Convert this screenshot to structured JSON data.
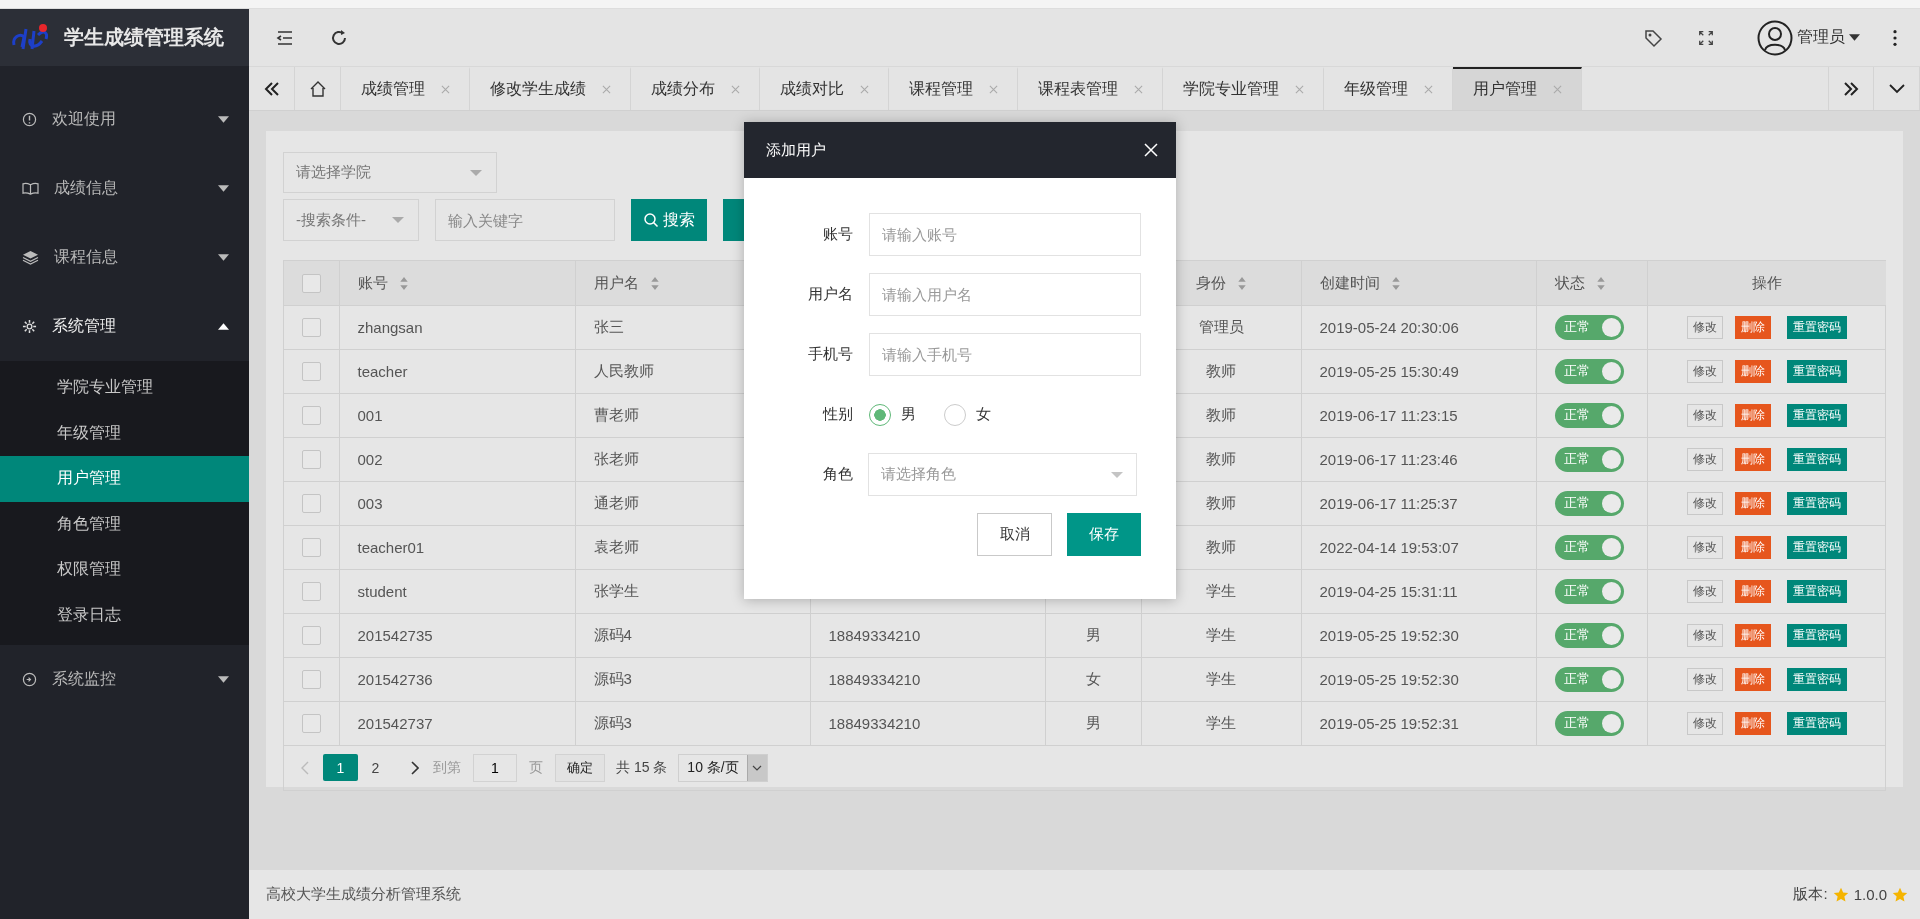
{
  "app": {
    "title": "学生成绩管理系统"
  },
  "sidebar": {
    "items": [
      {
        "label": "欢迎使用",
        "expanded": false
      },
      {
        "label": "成绩信息",
        "expanded": false
      },
      {
        "label": "课程信息",
        "expanded": false
      },
      {
        "label": "系统管理",
        "expanded": true,
        "children": [
          {
            "label": "学院专业管理",
            "selected": false
          },
          {
            "label": "年级管理",
            "selected": false
          },
          {
            "label": "用户管理",
            "selected": true
          },
          {
            "label": "角色管理",
            "selected": false
          },
          {
            "label": "权限管理",
            "selected": false
          },
          {
            "label": "登录日志",
            "selected": false
          }
        ]
      },
      {
        "label": "系统监控",
        "expanded": false
      }
    ]
  },
  "header": {
    "user": "管理员"
  },
  "tabs": [
    {
      "label": "成绩管理",
      "selected": false
    },
    {
      "label": "修改学生成绩",
      "selected": false
    },
    {
      "label": "成绩分布",
      "selected": false
    },
    {
      "label": "成绩对比",
      "selected": false
    },
    {
      "label": "课程管理",
      "selected": false
    },
    {
      "label": "课程表管理",
      "selected": false
    },
    {
      "label": "学院专业管理",
      "selected": false
    },
    {
      "label": "年级管理",
      "selected": false
    },
    {
      "label": "用户管理",
      "selected": true
    }
  ],
  "filters": {
    "college_placeholder": "请选择学院",
    "condition_placeholder": "-搜索条件-",
    "keyword_placeholder": "输入关键字",
    "search_button": "搜索"
  },
  "table": {
    "all_checked": false,
    "columns": [
      {
        "label": "账号",
        "sortable": true
      },
      {
        "label": "用户名",
        "sortable": true
      },
      {},
      {},
      {
        "label": "身份",
        "sortable": true
      },
      {
        "label": "创建时间",
        "sortable": true
      },
      {
        "label": "状态",
        "sortable": true
      },
      {
        "label": "操作",
        "sortable": false
      }
    ],
    "rows": [
      {
        "checked": false,
        "account": "zhangsan",
        "name": "张三",
        "role": "管理员",
        "created": "2019-05-24 20:30:06",
        "status": {
          "on": true,
          "label": "正常"
        },
        "actions": [
          {
            "kind": "edit",
            "label": "修改"
          },
          {
            "kind": "delete",
            "label": "删除"
          },
          {
            "kind": "reset",
            "label": "重置密码"
          }
        ]
      },
      {
        "checked": false,
        "account": "teacher",
        "name": "人民教师",
        "role": "教师",
        "created": "2019-05-25 15:30:49",
        "status": {
          "on": true,
          "label": "正常"
        },
        "actions": [
          {
            "kind": "edit",
            "label": "修改"
          },
          {
            "kind": "delete",
            "label": "删除"
          },
          {
            "kind": "reset",
            "label": "重置密码"
          }
        ]
      },
      {
        "checked": false,
        "account": "001",
        "name": "曹老师",
        "role": "教师",
        "created": "2019-06-17 11:23:15",
        "status": {
          "on": true,
          "label": "正常"
        },
        "actions": [
          {
            "kind": "edit",
            "label": "修改"
          },
          {
            "kind": "delete",
            "label": "删除"
          },
          {
            "kind": "reset",
            "label": "重置密码"
          }
        ]
      },
      {
        "checked": false,
        "account": "002",
        "name": "张老师",
        "role": "教师",
        "created": "2019-06-17 11:23:46",
        "status": {
          "on": true,
          "label": "正常"
        },
        "actions": [
          {
            "kind": "edit",
            "label": "修改"
          },
          {
            "kind": "delete",
            "label": "删除"
          },
          {
            "kind": "reset",
            "label": "重置密码"
          }
        ]
      },
      {
        "checked": false,
        "account": "003",
        "name": "通老师",
        "role": "教师",
        "created": "2019-06-17 11:25:37",
        "status": {
          "on": true,
          "label": "正常"
        },
        "actions": [
          {
            "kind": "edit",
            "label": "修改"
          },
          {
            "kind": "delete",
            "label": "删除"
          },
          {
            "kind": "reset",
            "label": "重置密码"
          }
        ]
      },
      {
        "checked": false,
        "account": "teacher01",
        "name": "袁老师",
        "role": "教师",
        "created": "2022-04-14 19:53:07",
        "status": {
          "on": true,
          "label": "正常"
        },
        "actions": [
          {
            "kind": "edit",
            "label": "修改"
          },
          {
            "kind": "delete",
            "label": "删除"
          },
          {
            "kind": "reset",
            "label": "重置密码"
          }
        ]
      },
      {
        "checked": false,
        "account": "student",
        "name": "张学生",
        "role": "学生",
        "created": "2019-04-25 15:31:11",
        "status": {
          "on": true,
          "label": "正常"
        },
        "actions": [
          {
            "kind": "edit",
            "label": "修改"
          },
          {
            "kind": "delete",
            "label": "删除"
          },
          {
            "kind": "reset",
            "label": "重置密码"
          }
        ]
      },
      {
        "checked": false,
        "account": "201542735",
        "name": "源码4",
        "phone": "18849334210",
        "gender": "男",
        "role": "学生",
        "created": "2019-05-25 19:52:30",
        "status": {
          "on": true,
          "label": "正常"
        },
        "actions": [
          {
            "kind": "edit",
            "label": "修改"
          },
          {
            "kind": "delete",
            "label": "删除"
          },
          {
            "kind": "reset",
            "label": "重置密码"
          }
        ]
      },
      {
        "checked": false,
        "account": "201542736",
        "name": "源码3",
        "phone": "18849334210",
        "gender": "女",
        "role": "学生",
        "created": "2019-05-25 19:52:30",
        "status": {
          "on": true,
          "label": "正常"
        },
        "actions": [
          {
            "kind": "edit",
            "label": "修改"
          },
          {
            "kind": "delete",
            "label": "删除"
          },
          {
            "kind": "reset",
            "label": "重置密码"
          }
        ]
      },
      {
        "checked": false,
        "account": "201542737",
        "name": "源码3",
        "phone": "18849334210",
        "gender": "男",
        "role": "学生",
        "created": "2019-05-25 19:52:31",
        "status": {
          "on": true,
          "label": "正常"
        },
        "actions": [
          {
            "kind": "edit",
            "label": "修改"
          },
          {
            "kind": "delete",
            "label": "删除"
          },
          {
            "kind": "reset",
            "label": "重置密码"
          }
        ]
      }
    ]
  },
  "pagination": {
    "pages": [
      {
        "label": "1",
        "selected": true
      },
      {
        "label": "2",
        "selected": false
      }
    ],
    "goto_label": "到第",
    "goto_value": "1",
    "page_unit": "页",
    "confirm": "确定",
    "total": "共 15 条",
    "page_size": "10 条/页"
  },
  "footer": {
    "text": "高校大学生成绩分析管理系统",
    "version_label": "版本:",
    "version": "1.0.0"
  },
  "dialog": {
    "title": "添加用户",
    "fields": [
      {
        "kind": "input",
        "label": "账号",
        "placeholder": "请输入账号"
      },
      {
        "kind": "input",
        "label": "用户名",
        "placeholder": "请输入用户名"
      },
      {
        "kind": "input",
        "label": "手机号",
        "placeholder": "请输入手机号"
      },
      {
        "kind": "radio",
        "label": "性别",
        "options": [
          {
            "label": "男",
            "selected": true
          },
          {
            "label": "女",
            "selected": false
          }
        ]
      },
      {
        "kind": "select",
        "label": "角色",
        "placeholder": "请选择角色"
      }
    ],
    "buttons": [
      {
        "kind": "secondary",
        "label": "取消"
      },
      {
        "kind": "primary",
        "label": "保存"
      }
    ]
  }
}
